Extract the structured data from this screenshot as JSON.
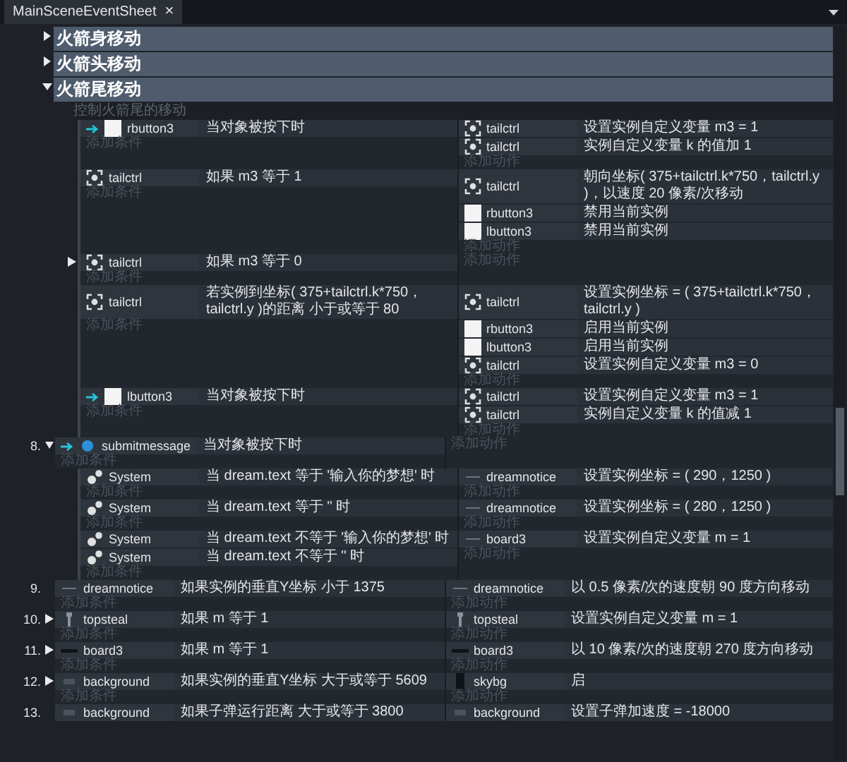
{
  "tab": {
    "label": "MainSceneEventSheet",
    "close": "×"
  },
  "groups": [
    {
      "title": "火箭身移动",
      "expanded": false
    },
    {
      "title": "火箭头移动",
      "expanded": false
    },
    {
      "title": "火箭尾移动",
      "expanded": true,
      "comment": "控制火箭尾的移动",
      "events": [
        {
          "trigger": true,
          "conditions": [
            {
              "kind": "sprite",
              "object": "rbutton3",
              "text": "当对象被按下时"
            }
          ],
          "actions": [
            {
              "kind": "target",
              "object": "tailctrl",
              "text": "设置实例自定义变量 m3 = 1"
            },
            {
              "kind": "target",
              "object": "tailctrl",
              "text": "实例自定义变量 k 的值加 1"
            }
          ],
          "add_condition": "添加条件",
          "add_action": "添加动作"
        },
        {
          "trigger": false,
          "conditions": [
            {
              "kind": "target",
              "object": "tailctrl",
              "text": "如果 m3 等于 1"
            }
          ],
          "actions": [
            {
              "kind": "target",
              "object": "tailctrl",
              "text": "朝向坐标( 375+tailctrl.k*750，tailctrl.y )，以速度 20 像素/次移动"
            },
            {
              "kind": "sprite",
              "object": "rbutton3",
              "text": "禁用当前实例"
            },
            {
              "kind": "sprite",
              "object": "lbutton3",
              "text": "禁用当前实例"
            }
          ],
          "add_condition": "添加条件",
          "add_action": "添加动作"
        },
        {
          "trigger": false,
          "expanded": false,
          "conditions": [
            {
              "kind": "target",
              "object": "tailctrl",
              "text": "如果 m3 等于 0"
            }
          ],
          "add_condition": "添加条件",
          "add_action": "添加动作"
        },
        {
          "trigger": false,
          "conditions": [
            {
              "kind": "target",
              "object": "tailctrl",
              "text": "若实例到坐标( 375+tailctrl.k*750，tailctrl.y )的距离 小于或等于 80"
            }
          ],
          "actions": [
            {
              "kind": "target",
              "object": "tailctrl",
              "text": "设置实例坐标 = ( 375+tailctrl.k*750，tailctrl.y )"
            },
            {
              "kind": "sprite",
              "object": "rbutton3",
              "text": "启用当前实例"
            },
            {
              "kind": "sprite",
              "object": "lbutton3",
              "text": "启用当前实例"
            },
            {
              "kind": "target",
              "object": "tailctrl",
              "text": "设置实例自定义变量 m3 = 0"
            }
          ],
          "add_condition": "添加条件",
          "add_action": "添加动作"
        },
        {
          "trigger": true,
          "conditions": [
            {
              "kind": "sprite",
              "object": "lbutton3",
              "text": "当对象被按下时"
            }
          ],
          "actions": [
            {
              "kind": "target",
              "object": "tailctrl",
              "text": "设置实例自定义变量 m3 = 1"
            },
            {
              "kind": "target",
              "object": "tailctrl",
              "text": "实例自定义变量 k 的值减 1"
            }
          ],
          "add_condition": "添加条件",
          "add_action": "添加动作"
        }
      ]
    }
  ],
  "events": [
    {
      "number": "8.",
      "expanded": true,
      "trigger": true,
      "conditions": [
        {
          "kind": "dot",
          "object": "submitmessage",
          "text": "当对象被按下时"
        }
      ],
      "add_condition": "添加条件",
      "add_action": "添加动作",
      "children": [
        {
          "trigger": false,
          "conditions": [
            {
              "kind": "gear",
              "object": "System",
              "text": "当 dream.text 等于 '输入你的梦想' 时"
            }
          ],
          "actions": [
            {
              "kind": "text",
              "object": "dreamnotice",
              "text": "设置实例坐标 = ( 290，1250 )"
            }
          ],
          "add_condition": "添加条件",
          "add_action": "添加动作"
        },
        {
          "trigger": false,
          "conditions": [
            {
              "kind": "gear",
              "object": "System",
              "text": "当 dream.text 等于 '' 时"
            }
          ],
          "actions": [
            {
              "kind": "text",
              "object": "dreamnotice",
              "text": "设置实例坐标 = ( 280，1250 )"
            }
          ],
          "add_condition": "添加条件",
          "add_action": "添加动作"
        },
        {
          "trigger": false,
          "conditions": [
            {
              "kind": "gear",
              "object": "System",
              "text": "当 dream.text 不等于 '输入你的梦想' 时"
            },
            {
              "kind": "gear",
              "object": "System",
              "text": "当 dream.text 不等于 '' 时"
            }
          ],
          "actions": [
            {
              "kind": "text",
              "object": "board3",
              "text": "设置实例自定义变量 m = 1"
            }
          ],
          "add_condition": "添加条件",
          "add_action": "添加动作"
        }
      ]
    },
    {
      "number": "9.",
      "trigger": false,
      "conditions": [
        {
          "kind": "text",
          "object": "dreamnotice",
          "text": "如果实例的垂直Y坐标 小于 1375"
        }
      ],
      "actions": [
        {
          "kind": "text",
          "object": "dreamnotice",
          "text": "以 0.5 像素/次的速度朝 90 度方向移动"
        }
      ],
      "add_condition": "添加条件",
      "add_action": "添加动作"
    },
    {
      "number": "10.",
      "expanded": false,
      "trigger": false,
      "conditions": [
        {
          "kind": "figure",
          "object": "topsteal",
          "text": "如果 m 等于 1"
        }
      ],
      "actions": [
        {
          "kind": "figure",
          "object": "topsteal",
          "text": "设置实例自定义变量 m = 1"
        }
      ],
      "add_condition": "添加条件",
      "add_action": "添加动作"
    },
    {
      "number": "11.",
      "expanded": false,
      "trigger": false,
      "conditions": [
        {
          "kind": "bar",
          "object": "board3",
          "text": "如果 m 等于 1"
        }
      ],
      "actions": [
        {
          "kind": "bar",
          "object": "board3",
          "text": "以 10 像素/次的速度朝 270 度方向移动"
        }
      ],
      "add_condition": "添加条件",
      "add_action": "添加动作"
    },
    {
      "number": "12.",
      "expanded": false,
      "trigger": false,
      "conditions": [
        {
          "kind": "tile",
          "object": "background",
          "text": "如果实例的垂直Y坐标 大于或等于 5609"
        }
      ],
      "actions": [
        {
          "kind": "block",
          "object": "skybg",
          "text": "启"
        }
      ],
      "add_condition": "添加条件",
      "add_action": "添加动作"
    },
    {
      "number": "13.",
      "trigger": false,
      "conditions": [
        {
          "kind": "tile",
          "object": "background",
          "text": "如果子弹运行距离 大于或等于 3800"
        }
      ],
      "actions": [
        {
          "kind": "tile",
          "object": "background",
          "text": "设置子弹加速度 = -18000"
        }
      ]
    }
  ]
}
